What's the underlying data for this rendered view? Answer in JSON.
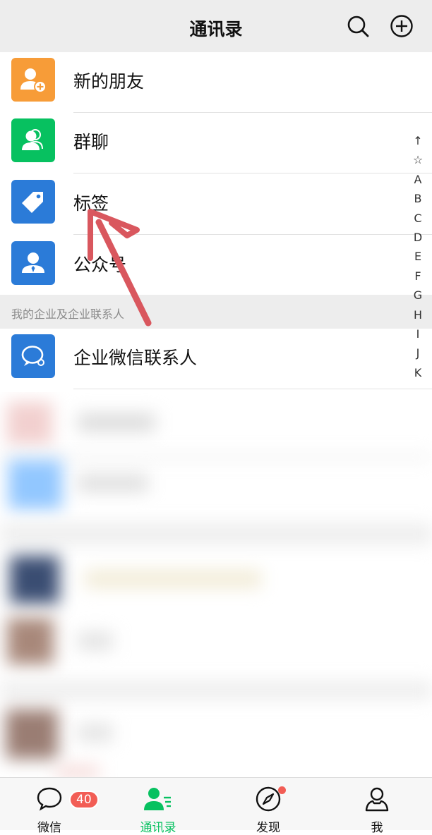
{
  "header": {
    "title": "通讯录",
    "search_icon": "search-icon",
    "add_icon": "plus-circle-icon"
  },
  "rows": [
    {
      "label": "新的朋友",
      "color": "#f79c38",
      "icon": "add-friend-icon"
    },
    {
      "label": "群聊",
      "color": "#07c160",
      "icon": "group-chat-icon"
    },
    {
      "label": "标签",
      "color": "#2b7bd8",
      "icon": "tag-icon"
    },
    {
      "label": "公众号",
      "color": "#2b7bd8",
      "icon": "official-account-icon"
    }
  ],
  "section": {
    "label": "我的企业及企业联系人"
  },
  "enterprise": {
    "label": "企业微信联系人",
    "color": "#2b7bd8",
    "icon": "work-chat-icon"
  },
  "index_letters": [
    "↑",
    "☆",
    "A",
    "B",
    "C",
    "D",
    "E",
    "F",
    "G",
    "H",
    "I",
    "J",
    "K"
  ],
  "tabs": [
    {
      "label": "微信",
      "badge": "40",
      "active": false,
      "icon": "chat-bubble-icon"
    },
    {
      "label": "通讯录",
      "active": true,
      "icon": "contacts-icon"
    },
    {
      "label": "发现",
      "active": false,
      "icon": "compass-icon"
    },
    {
      "label": "我",
      "active": false,
      "icon": "person-icon"
    }
  ],
  "colors": {
    "accent": "#07c160",
    "badge": "#f25d55",
    "annotation_arrow": "#d9575e"
  }
}
